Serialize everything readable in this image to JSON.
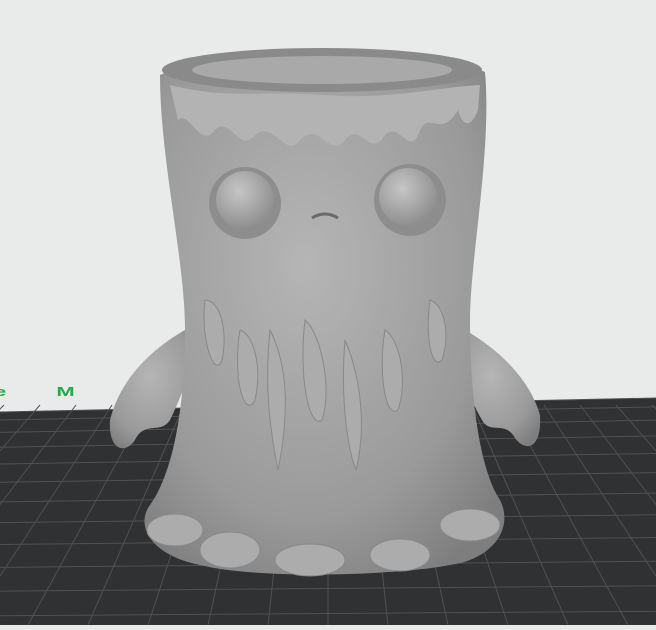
{
  "viewport": {
    "bed_label": "e M",
    "colors": {
      "background": "#e9eaea",
      "bed": "#2f3132",
      "grid": "#555859",
      "model": "#9c9c9c",
      "label": "#1fae4a"
    }
  }
}
